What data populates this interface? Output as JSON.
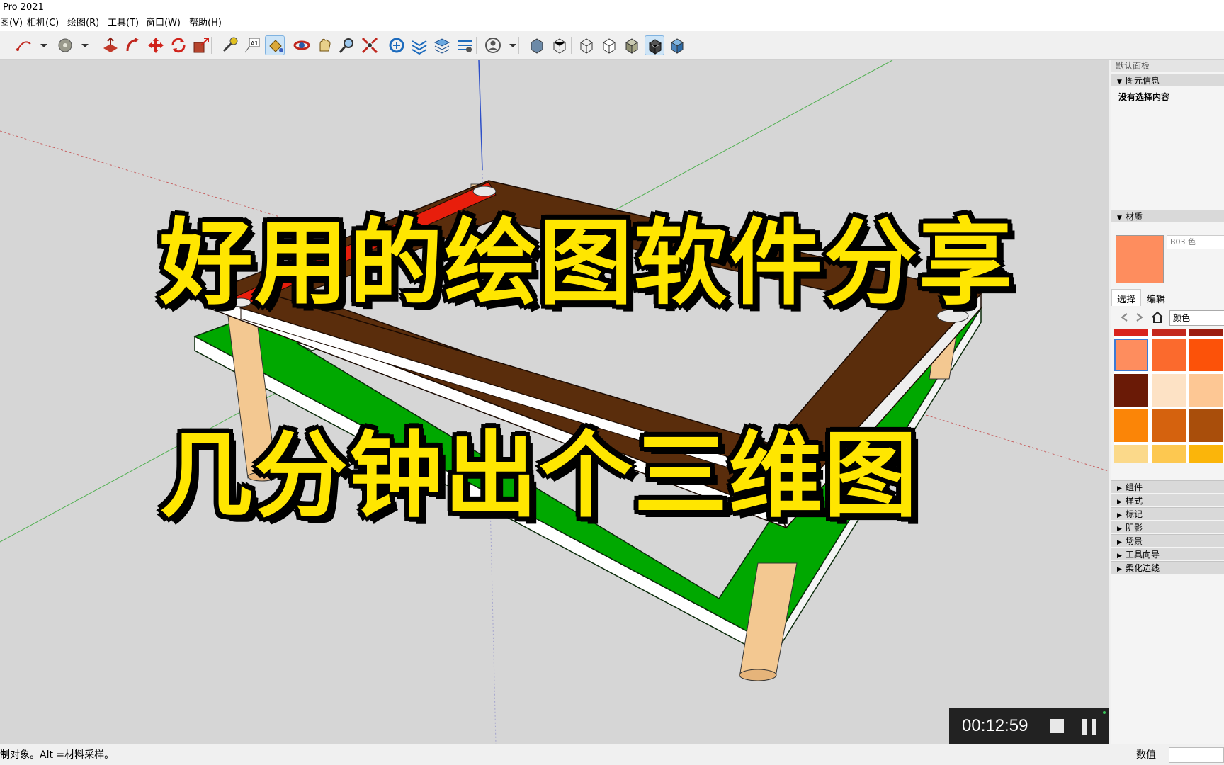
{
  "window": {
    "title": "Pro 2021"
  },
  "menu": [
    {
      "label": "图(V)"
    },
    {
      "label": "相机(C)"
    },
    {
      "label": "绘图(R)"
    },
    {
      "label": "工具(T)"
    },
    {
      "label": "窗口(W)"
    },
    {
      "label": "帮助(H)"
    }
  ],
  "toolbar": {
    "icons": [
      "arc-icon",
      "eraser-icon",
      "push-pull-icon",
      "follow-me-icon",
      "move-icon",
      "rotate-icon",
      "scale-icon",
      "tape-measure-icon",
      "text-icon",
      "paint-bucket-icon",
      "orbit-icon",
      "pan-icon",
      "zoom-icon",
      "zoom-extents-icon",
      "warehouse-icon",
      "extension-icon",
      "layers-icon",
      "sandbox-icon",
      "user-icon",
      "xray-icon",
      "back-edges-icon",
      "wireframe-icon",
      "hidden-line-icon",
      "shaded-icon",
      "shaded-textures-icon",
      "monochrome-icon"
    ]
  },
  "overlay": {
    "line1": "好用的绘图软件分享",
    "line2": "几分钟出个三维图"
  },
  "recorder": {
    "time": "00:12:59"
  },
  "panel": {
    "title": "默认面板",
    "entity_info": {
      "header": "图元信息",
      "text": "没有选择内容"
    },
    "materials": {
      "header": "材质",
      "current_name": "B03 色",
      "current_color": "#fe8d5e",
      "tab_select": "选择",
      "tab_edit": "编辑",
      "library": "颜色",
      "swatches": [
        "#d9231c",
        "#c4281c",
        "#9b1e10",
        "#fe8d5e",
        "#fb6a2d",
        "#fc5209",
        "#6a1a06",
        "#fde2c5",
        "#fdc794",
        "#fb8507",
        "#d5620e",
        "#a94e0b",
        "#fbd98a",
        "#fdc850",
        "#fbb50a"
      ]
    },
    "sections": [
      "组件",
      "样式",
      "标记",
      "阴影",
      "场景",
      "工具向导",
      "柔化边线"
    ]
  },
  "status": {
    "hint": "制对象。Alt =材料采样。",
    "measure_label": "数值"
  },
  "colors": {
    "viewport_bg": "#d6d6d6",
    "overlay_text": "#ffe600",
    "frame_brown": "#5a2d0c",
    "base_green": "#00a800",
    "leg_tan": "#f3c891",
    "accent_red": "#e81e0c"
  }
}
